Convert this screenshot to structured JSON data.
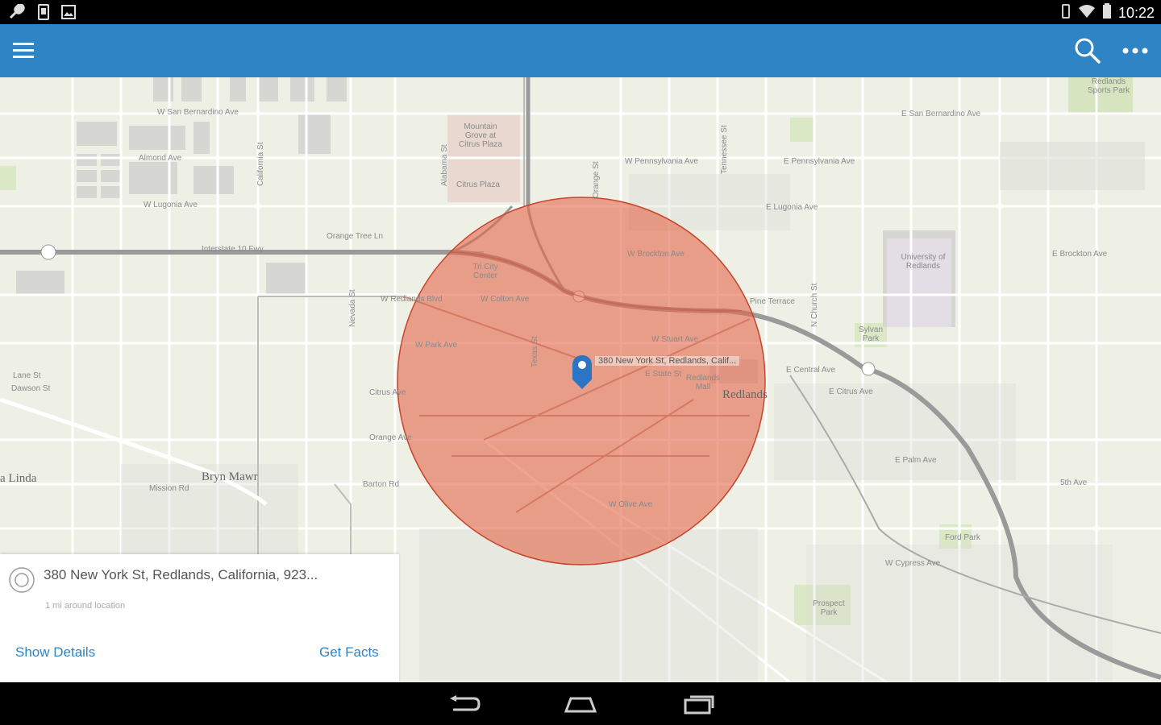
{
  "status_bar": {
    "time": "10:22",
    "left_icons": [
      "wrench-icon",
      "sd-card-icon",
      "image-icon"
    ],
    "right_icons": [
      "vibrate-icon",
      "wifi-icon",
      "battery-icon"
    ]
  },
  "app_bar": {
    "color": "#2f84c6",
    "icons": [
      "menu-icon",
      "search-icon",
      "overflow-icon"
    ]
  },
  "map": {
    "buffer_color": "#e5664a",
    "pin_color": "#2c74c4",
    "pin_label": "380 New York St, Redlands, Calif...",
    "labels": {
      "w_san_bernardino": "W San Bernardino Ave",
      "e_san_bernardino": "E San Bernardino Ave",
      "almond": "Almond Ave",
      "w_lugonia": "W Lugonia Ave",
      "e_lugonia": "E Lugonia Ave",
      "w_pennsylvania": "W Pennsylvania Ave",
      "e_pennsylvania": "E Pennsylvania Ave",
      "mountain_grove": "Mountain Grove at Citrus Plaza",
      "citrus_plaza": "Citrus Plaza",
      "orange_tree": "Orange Tree Ln",
      "freeway": "Interstate 10 Fwy",
      "tri_city": "Tri City Center",
      "w_brockton": "W Brockton Ave",
      "e_brockton": "E Brockton Ave",
      "w_redlands": "W Redlands Blvd",
      "w_colton": "W Colton Ave",
      "w_stuart": "W Stuart Ave",
      "w_park": "W Park Ave",
      "e_central": "E Central Ave",
      "e_citrus": "E Citrus Ave",
      "citrus_ave": "Citrus Ave",
      "orange_ave": "Orange Ave",
      "state_st": "E State St",
      "redlands_mall": "Redlands Mall",
      "redlands_town": "Redlands",
      "university": "University of Redlands",
      "sylvan_park": "Sylvan Park",
      "ford_park": "Ford Park",
      "prospect_park": "Prospect Park",
      "bryn_mawr": "Bryn Mawr",
      "loma_linda": "a Linda",
      "redlands_sports": "Redlands Sports Park",
      "church": "N Church St",
      "e_5th": "5th Ave",
      "barton": "Barton Rd",
      "mission": "Mission Rd",
      "nevada": "Nevada St",
      "california": "California St",
      "alabama": "Alabama St",
      "texas": "Texas St",
      "tennessee": "Tennessee St",
      "orange_st": "Orange St",
      "lane_st": "Lane St",
      "dawson": "Dawson St",
      "terrace": "Pine Terrace",
      "w_cypress": "W Cypress Ave",
      "e_palm": "E Palm Ave",
      "w_olive": "W Olive Ave"
    }
  },
  "card": {
    "address": "380 New York St, Redlands, California, 923...",
    "subtitle": "1 mi around location",
    "show_details": "Show Details",
    "get_facts": "Get Facts"
  },
  "nav_bar": {
    "icons": [
      "back-icon",
      "home-icon",
      "recents-icon"
    ]
  }
}
